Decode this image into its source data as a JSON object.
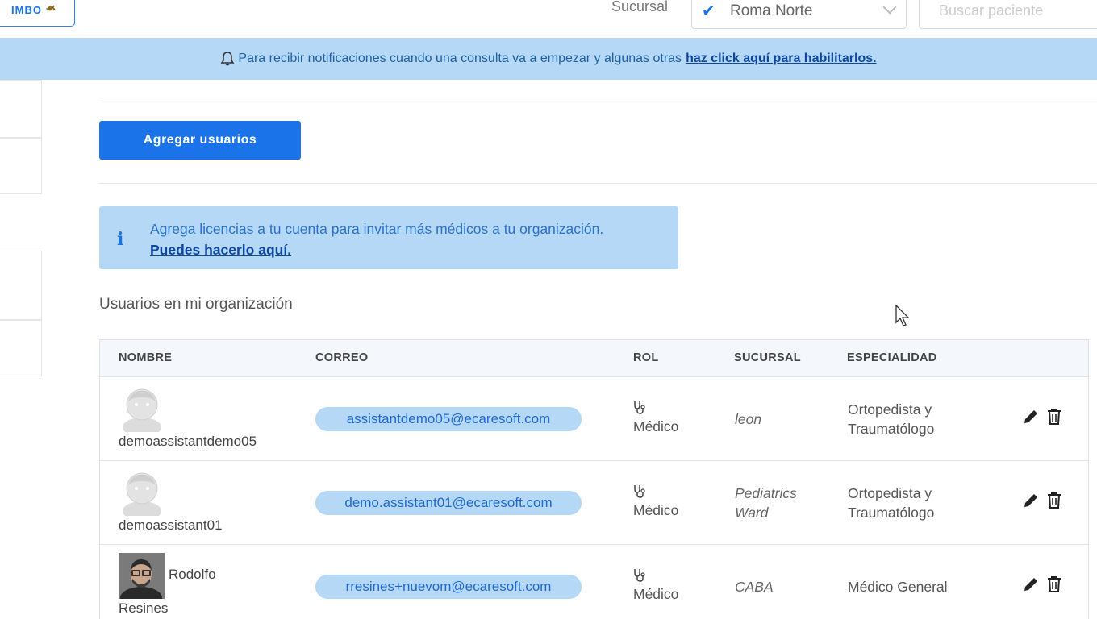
{
  "topbar": {
    "timbo_label": "IMBO",
    "sucursal_label": "Sucursal",
    "sucursal_value": "Roma Norte",
    "search_placeholder": "Buscar paciente"
  },
  "banner": {
    "text": "Para recibir notificaciones cuando una consulta va a empezar y algunas otras",
    "link": "haz click aquí para habilitarlos."
  },
  "main": {
    "add_button": "Agregar usuarios",
    "info": {
      "text": "Agrega licencias a tu cuenta para invitar más médicos a tu organización.",
      "link": "Puedes hacerlo aquí."
    },
    "section_title": "Usuarios en mi organización"
  },
  "table": {
    "headers": [
      "NOMBRE",
      "CORREO",
      "ROL",
      "SUCURSAL",
      "ESPECIALIDAD"
    ],
    "rows": [
      {
        "name": "demoassistantdemo05",
        "email": "assistantdemo05@ecaresoft.com",
        "role": "Médico",
        "sucursal_1": "leon",
        "sucursal_2": "",
        "especialidad_1": "Ortopedista y",
        "especialidad_2": "Traumatólogo"
      },
      {
        "name": "demoassistant01",
        "email": "demo.assistant01@ecaresoft.com",
        "role": "Médico",
        "sucursal_1": "Pediatrics",
        "sucursal_2": "Ward",
        "especialidad_1": "Ortopedista y",
        "especialidad_2": "Traumatólogo"
      },
      {
        "name_first": "Rodolfo",
        "name_last": "Resines",
        "email": "rresines+nuevom@ecaresoft.com",
        "role": "Médico",
        "sucursal_1": "CABA",
        "especialidad_1": "Médico General"
      }
    ]
  },
  "colors": {
    "accent": "#1a73e8",
    "banner_bg": "#b6d8f7",
    "header_bg": "#f4f8fc"
  }
}
